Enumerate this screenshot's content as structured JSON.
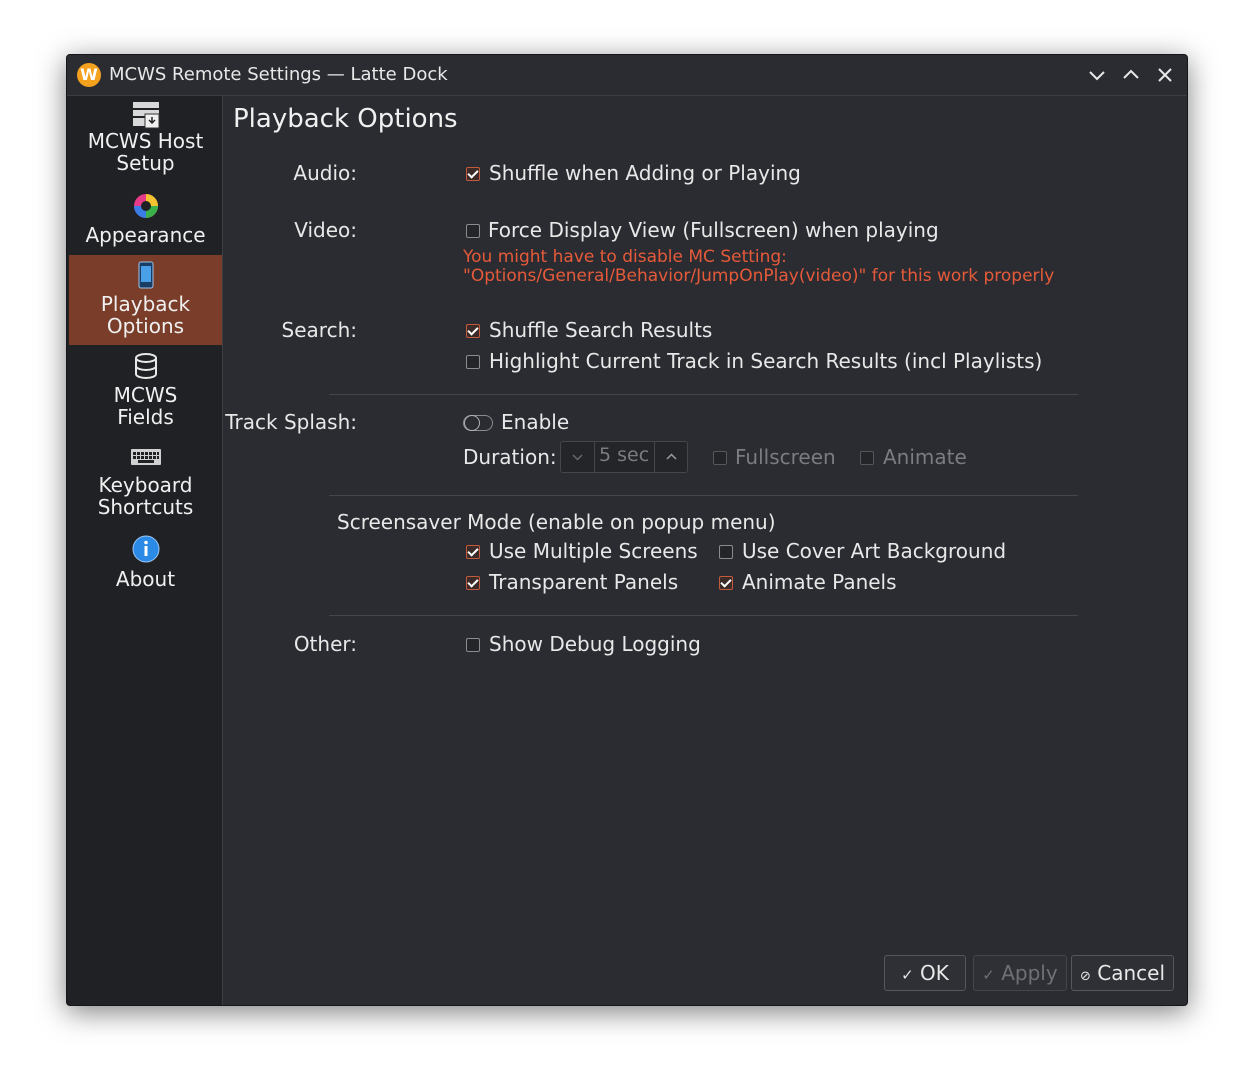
{
  "window": {
    "title": "MCWS Remote Settings — Latte Dock",
    "app_icon_letter": "W"
  },
  "sidebar": {
    "items": [
      {
        "label_line1": "MCWS Host",
        "label_line2": "Setup",
        "icon": "host-setup-icon"
      },
      {
        "label_line1": "Appearance",
        "label_line2": "",
        "icon": "color-wheel-icon"
      },
      {
        "label_line1": "Playback",
        "label_line2": "Options",
        "icon": "phone-icon",
        "active": true
      },
      {
        "label_line1": "MCWS",
        "label_line2": "Fields",
        "icon": "database-icon"
      },
      {
        "label_line1": "Keyboard",
        "label_line2": "Shortcuts",
        "icon": "keyboard-icon"
      },
      {
        "label_line1": "About",
        "label_line2": "",
        "icon": "info-icon"
      }
    ]
  },
  "page": {
    "title": "Playback Options",
    "audio": {
      "label": "Audio:",
      "shuffle": {
        "text": "Shuffle when Adding or Playing",
        "checked": true
      }
    },
    "video": {
      "label": "Video:",
      "force_display": {
        "text": "Force Display View (Fullscreen) when playing",
        "checked": false
      },
      "warning_line1": "You might have to disable MC Setting:",
      "warning_line2": "\"Options/General/Behavior/JumpOnPlay(video)\" for this work properly"
    },
    "search": {
      "label": "Search:",
      "shuffle_results": {
        "text": "Shuffle Search Results",
        "checked": true
      },
      "highlight_track": {
        "text": "Highlight Current Track in Search Results (incl Playlists)",
        "checked": false
      }
    },
    "track_splash": {
      "label": "Track Splash:",
      "enable_text": "Enable",
      "duration_label": "Duration:",
      "duration_value": "5 sec",
      "fullscreen": {
        "text": "Fullscreen",
        "checked": false
      },
      "animate": {
        "text": "Animate",
        "checked": false
      }
    },
    "screensaver": {
      "heading": "Screensaver Mode (enable on popup menu)",
      "multiple_screens": {
        "text": "Use Multiple Screens",
        "checked": true
      },
      "cover_art": {
        "text": "Use Cover Art Background",
        "checked": false
      },
      "transparent_panels": {
        "text": "Transparent Panels",
        "checked": true
      },
      "animate_panels": {
        "text": "Animate Panels",
        "checked": true
      }
    },
    "other": {
      "label": "Other:",
      "debug": {
        "text": "Show Debug Logging",
        "checked": false
      }
    }
  },
  "buttons": {
    "ok": "OK",
    "apply": "Apply",
    "cancel": "Cancel"
  },
  "colors": {
    "accent": "#c45a3d",
    "active_nav": "#7a3d2a",
    "warning": "#e65a3a",
    "background": "#2a2c31"
  }
}
